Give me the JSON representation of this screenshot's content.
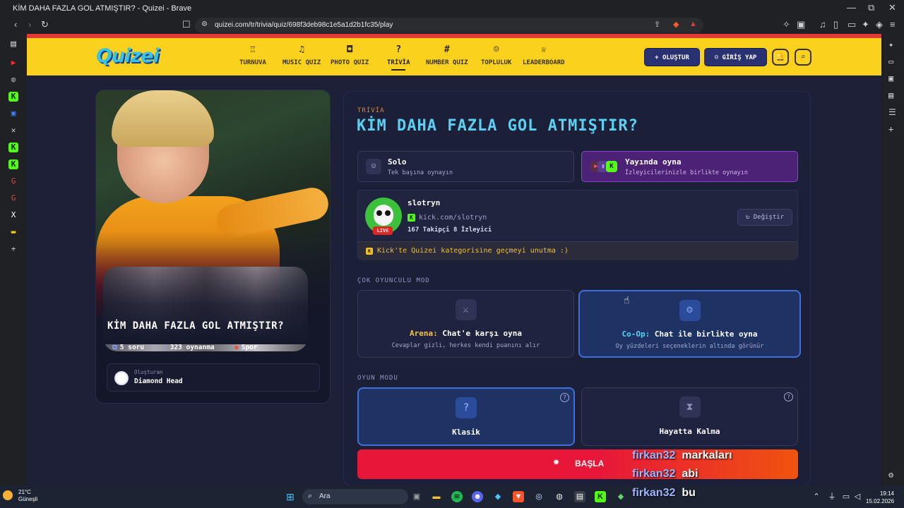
{
  "window": {
    "title": "KİM DAHA FAZLA GOL ATMIŞTIR? - Quizei - Brave",
    "minimize": "—",
    "maximize": "⧉",
    "close": "✕"
  },
  "browser": {
    "url": "quizei.com/tr/trivia/quiz/698f3deb98c1e5a1d2b1fc35/play"
  },
  "nav": {
    "logo": "Quizei",
    "items": [
      {
        "label": "TURNUVA",
        "icon": "trophy-icon",
        "glyph": "♖"
      },
      {
        "label": "MUSIC QUIZ",
        "icon": "music-icon",
        "glyph": "♫"
      },
      {
        "label": "PHOTO QUIZ",
        "icon": "camera-icon",
        "glyph": "◘"
      },
      {
        "label": "TRİVİA",
        "icon": "question-icon",
        "glyph": "?"
      },
      {
        "label": "NUMBER QUIZ",
        "icon": "hash-icon",
        "glyph": "#"
      },
      {
        "label": "TOPLULUK",
        "icon": "users-icon",
        "glyph": "☺"
      },
      {
        "label": "LEADERBOARD",
        "icon": "crown-icon",
        "glyph": "♕"
      }
    ],
    "create_label": "+ OLUŞTUR",
    "login_label": "GİRİŞ YAP",
    "login_icon": "☺",
    "bell_icon": "🔔",
    "search_icon": "⌕"
  },
  "quiz_card": {
    "title": "KİM DAHA FAZLA GOL ATMIŞTIR?",
    "questions": "5 soru",
    "plays": "323 oynanma",
    "category": "Spor",
    "creator_label": "Oluşturan",
    "creator_name": "Diamond Head"
  },
  "panel": {
    "category": "TRİVİA",
    "title": "KİM DAHA FAZLA GOL ATMIŞTIR?",
    "solo": {
      "title": "Solo",
      "desc": "Tek başına oynayın"
    },
    "stream": {
      "title": "Yayında oyna",
      "desc": "İzleyicilerinizle birlikte oynayın"
    },
    "channel": {
      "name": "slotryn",
      "url": "kick.com/slotryn",
      "stats": "167 Takipçi  8 İzleyici",
      "live": "LIVE",
      "change": "Değiştir",
      "notice": "Kick'te Quizei kategorisine geçmeyi unutma :)"
    },
    "multiplayer_heading": "ÇOK OYUNCULU MOD",
    "arena": {
      "prefix": "Arena:",
      "title": "Chat'e karşı oyna",
      "desc": "Cevaplar gizli, herkes kendi puanını alır"
    },
    "coop": {
      "prefix": "Co-Op:",
      "title": "Chat ile birlikte oyna",
      "desc": "Oy yüzdeleri seçeneklerin altında görünür"
    },
    "game_mode_heading": "OYUN MODU",
    "classic": "Klasik",
    "survival": "Hayatta Kalma",
    "start": "BAŞLA"
  },
  "chat": [
    {
      "user": "firkan32",
      "msg": "markaları"
    },
    {
      "user": "firkan32",
      "msg": "abi"
    },
    {
      "user": "firkan32",
      "msg": "bu"
    }
  ],
  "taskbar": {
    "temp": "21°C",
    "weather": "Güneşli",
    "search": "Ara",
    "time": "19:14",
    "date": "15.02.2026"
  },
  "colors": {
    "nav_bg": "#fad21e",
    "title_cyan": "#5ad1f2",
    "start_red": "#e8173a",
    "kick_green": "#53fc18"
  }
}
